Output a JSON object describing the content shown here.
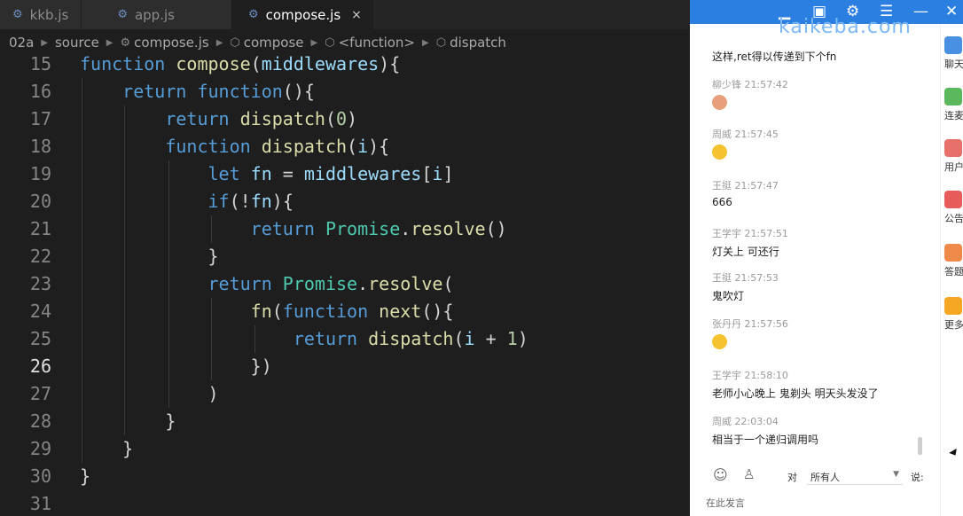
{
  "editor": {
    "tabs": [
      {
        "label": "kkb.js",
        "active": false
      },
      {
        "label": "app.js",
        "active": false
      },
      {
        "label": "compose.js",
        "active": true
      }
    ],
    "tab_close_glyph": "×",
    "breadcrumb": [
      "02a",
      "source",
      "compose.js",
      "compose",
      "<function>",
      "dispatch"
    ],
    "line_numbers": [
      "15",
      "16",
      "17",
      "18",
      "19",
      "20",
      "21",
      "22",
      "23",
      "24",
      "25",
      "26",
      "27",
      "28",
      "29",
      "30",
      "31"
    ],
    "current_line": "26",
    "code": [
      [
        [
          "kw",
          "function"
        ],
        [
          "",
          " "
        ],
        [
          "fn",
          "compose"
        ],
        [
          "",
          "("
        ],
        [
          "var",
          "middlewares"
        ],
        [
          "",
          "){"
        ]
      ],
      [
        [
          "",
          "    "
        ],
        [
          "kw",
          "return"
        ],
        [
          "",
          " "
        ],
        [
          "kw",
          "function"
        ],
        [
          "",
          "(){"
        ]
      ],
      [
        [
          "",
          "        "
        ],
        [
          "kw",
          "return"
        ],
        [
          "",
          " "
        ],
        [
          "fn",
          "dispatch"
        ],
        [
          "",
          "("
        ],
        [
          "num",
          "0"
        ],
        [
          "",
          ")"
        ]
      ],
      [
        [
          "",
          "        "
        ],
        [
          "kw",
          "function"
        ],
        [
          "",
          " "
        ],
        [
          "fn",
          "dispatch"
        ],
        [
          "",
          "("
        ],
        [
          "var",
          "i"
        ],
        [
          "",
          "){"
        ]
      ],
      [
        [
          "",
          "            "
        ],
        [
          "kw",
          "let"
        ],
        [
          "",
          " "
        ],
        [
          "var",
          "fn"
        ],
        [
          "",
          " = "
        ],
        [
          "var",
          "middlewares"
        ],
        [
          "",
          "["
        ],
        [
          "var",
          "i"
        ],
        [
          "",
          "]"
        ]
      ],
      [
        [
          "",
          "            "
        ],
        [
          "kw",
          "if"
        ],
        [
          "",
          "(!"
        ],
        [
          "var",
          "fn"
        ],
        [
          "",
          "){"
        ]
      ],
      [
        [
          "",
          "                "
        ],
        [
          "kw",
          "return"
        ],
        [
          "",
          " "
        ],
        [
          "cls",
          "Promise"
        ],
        [
          "",
          "."
        ],
        [
          "fn",
          "resolve"
        ],
        [
          "",
          "()"
        ]
      ],
      [
        [
          "",
          "            }"
        ]
      ],
      [
        [
          "",
          "            "
        ],
        [
          "kw",
          "return"
        ],
        [
          "",
          " "
        ],
        [
          "cls",
          "Promise"
        ],
        [
          "",
          "."
        ],
        [
          "fn",
          "resolve"
        ],
        [
          "",
          "("
        ]
      ],
      [
        [
          "",
          "                "
        ],
        [
          "fn",
          "fn"
        ],
        [
          "",
          "("
        ],
        [
          "kw",
          "function"
        ],
        [
          "",
          " "
        ],
        [
          "fn",
          "next"
        ],
        [
          "",
          "(){"
        ]
      ],
      [
        [
          "",
          "                    "
        ],
        [
          "kw",
          "return"
        ],
        [
          "",
          " "
        ],
        [
          "fn",
          "dispatch"
        ],
        [
          "",
          "("
        ],
        [
          "var",
          "i"
        ],
        [
          "",
          " + "
        ],
        [
          "num",
          "1"
        ],
        [
          "",
          ")"
        ]
      ],
      [
        [
          "",
          "                })"
        ]
      ],
      [
        [
          "",
          "            )"
        ]
      ],
      [
        [
          "",
          "        }"
        ]
      ],
      [
        [
          "",
          "    }"
        ]
      ],
      [
        [
          "",
          "}"
        ]
      ],
      [
        [
          "",
          ""
        ]
      ]
    ]
  },
  "chat": {
    "brand": "kaikeba.com",
    "messages": [
      {
        "header": "",
        "body": "这样,ret得以传递到下个fn",
        "emoji": ""
      },
      {
        "header": "柳少锋 21:57:42",
        "body": "",
        "emoji": "peach"
      },
      {
        "header": "周威 21:57:45",
        "body": "",
        "emoji": "laugh"
      },
      {
        "header": "王挺 21:57:47",
        "body": "666",
        "emoji": ""
      },
      {
        "header": "王学宇 21:57:51",
        "body": "灯关上 可还行",
        "emoji": ""
      },
      {
        "header": "王挺 21:57:53",
        "body": "鬼吹灯",
        "emoji": ""
      },
      {
        "header": "张丹丹 21:57:56",
        "body": "",
        "emoji": "laugh"
      },
      {
        "header": "王学宇 21:58:10",
        "body": "老师小心晚上 鬼剃头 明天头发没了",
        "emoji": ""
      },
      {
        "header": "周威 22:03:04",
        "body": "相当于一个递归调用吗",
        "emoji": ""
      }
    ],
    "input": {
      "to_label": "对",
      "recipient": "所有人",
      "say_label": "说:",
      "placeholder": "在此发言"
    },
    "side_items": [
      {
        "label": "聊天",
        "color": "#4a90e2"
      },
      {
        "label": "连麦",
        "color": "#5cb85c"
      },
      {
        "label": "用户",
        "color": "#e8706a"
      },
      {
        "label": "公告",
        "color": "#e85b5b"
      },
      {
        "label": "答题卡",
        "color": "#f08a4b"
      },
      {
        "label": "更多",
        "color": "#f5a623"
      }
    ]
  }
}
